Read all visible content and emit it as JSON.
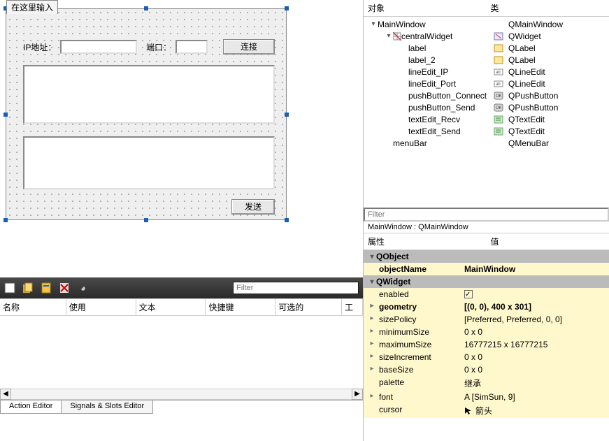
{
  "designer": {
    "tab_label": "在这里输入",
    "ip_label": "IP地址：",
    "port_label": "端口：",
    "connect_label": "连接",
    "send_label": "发送"
  },
  "darkbar": {
    "filter_placeholder": "Filter"
  },
  "action_grid": {
    "cols": [
      "名称",
      "使用",
      "文本",
      "快捷键",
      "可选的",
      "工"
    ],
    "tabs": [
      "Action Editor",
      "Signals & Slots Editor"
    ]
  },
  "objtree": {
    "headers": [
      "对象",
      "类"
    ],
    "rows": [
      {
        "name": "MainWindow",
        "cls": "QMainWindow",
        "lvl": 0,
        "caret": "▾",
        "icon": "none"
      },
      {
        "name": "centralWidget",
        "cls": "QWidget",
        "lvl": 1,
        "caret": "▾",
        "icon": "widget",
        "gg": true
      },
      {
        "name": "label",
        "cls": "QLabel",
        "lvl": 2,
        "caret": "",
        "icon": "label"
      },
      {
        "name": "label_2",
        "cls": "QLabel",
        "lvl": 2,
        "caret": "",
        "icon": "label"
      },
      {
        "name": "lineEdit_IP",
        "cls": "QLineEdit",
        "lvl": 2,
        "caret": "",
        "icon": "line"
      },
      {
        "name": "lineEdit_Port",
        "cls": "QLineEdit",
        "lvl": 2,
        "caret": "",
        "icon": "line"
      },
      {
        "name": "pushButton_Connect",
        "cls": "QPushButton",
        "lvl": 2,
        "caret": "",
        "icon": "btn"
      },
      {
        "name": "pushButton_Send",
        "cls": "QPushButton",
        "lvl": 2,
        "caret": "",
        "icon": "btn"
      },
      {
        "name": "textEdit_Recv",
        "cls": "QTextEdit",
        "lvl": 2,
        "caret": "",
        "icon": "text"
      },
      {
        "name": "textEdit_Send",
        "cls": "QTextEdit",
        "lvl": 2,
        "caret": "",
        "icon": "text"
      },
      {
        "name": "menuBar",
        "cls": "QMenuBar",
        "lvl": 1,
        "caret": "",
        "icon": "none"
      }
    ]
  },
  "prop": {
    "filter_placeholder": "Filter",
    "title": "MainWindow : QMainWindow",
    "headers": [
      "属性",
      "值"
    ],
    "sections": [
      {
        "name": "QObject",
        "rows": [
          {
            "n": "objectName",
            "v": "MainWindow",
            "bold": true
          }
        ]
      },
      {
        "name": "QWidget",
        "rows": [
          {
            "n": "enabled",
            "v": "",
            "chk": true
          },
          {
            "n": "geometry",
            "v": "[(0, 0), 400 x 301]",
            "bold": true,
            "exp": true
          },
          {
            "n": "sizePolicy",
            "v": "[Preferred, Preferred, 0, 0]",
            "exp": true
          },
          {
            "n": "minimumSize",
            "v": "0 x 0",
            "exp": true
          },
          {
            "n": "maximumSize",
            "v": "16777215 x 16777215",
            "exp": true
          },
          {
            "n": "sizeIncrement",
            "v": "0 x 0",
            "exp": true
          },
          {
            "n": "baseSize",
            "v": "0 x 0",
            "exp": true
          },
          {
            "n": "palette",
            "v": "继承"
          },
          {
            "n": "font",
            "v": "A  [SimSun, 9]",
            "exp": true
          },
          {
            "n": "cursor",
            "v": "箭头",
            "arrow": true
          }
        ]
      }
    ]
  }
}
